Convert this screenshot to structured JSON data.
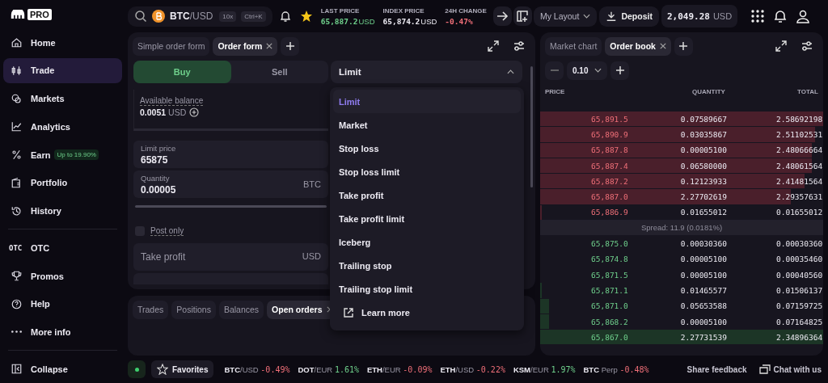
{
  "logo": {
    "badge": "PRO"
  },
  "sidebar": {
    "main": [
      {
        "label": "Home",
        "selected": false
      },
      {
        "label": "Trade",
        "selected": true
      },
      {
        "label": "Markets",
        "selected": false
      },
      {
        "label": "Analytics",
        "selected": false
      },
      {
        "label": "Earn",
        "selected": false,
        "badge": "Up to 19.90%"
      },
      {
        "label": "Portfolio",
        "selected": false
      },
      {
        "label": "History",
        "selected": false
      }
    ],
    "more": [
      {
        "label": "OTC",
        "icon_text": "OTC"
      },
      {
        "label": "Promos"
      },
      {
        "label": "Help"
      },
      {
        "label": "More info"
      }
    ],
    "collapse": "Collapse"
  },
  "topbar": {
    "pair": {
      "base": "BTC",
      "quote": "/USD",
      "leverage": "10x",
      "shortcut": "Ctrl+K"
    },
    "stats": [
      {
        "label": "LAST PRICE",
        "value": "65,887.2",
        "unit": "USD",
        "color": "#6fd08c"
      },
      {
        "label": "INDEX PRICE",
        "value": "65,874.2",
        "unit": "USD",
        "color": "#eceaf2"
      },
      {
        "label": "24H CHANGE",
        "value": "-0.47%",
        "color": "#ef6f78"
      }
    ],
    "layout": "My Layout",
    "deposit": "Deposit",
    "balance": {
      "amount": "2,049.28",
      "unit": "USD"
    }
  },
  "order_form": {
    "tabs": [
      {
        "label": "Simple order form",
        "selected": false,
        "closable": false
      },
      {
        "label": "Order form",
        "selected": true,
        "closable": true
      }
    ],
    "sides": [
      {
        "label": "Buy",
        "selected": true
      },
      {
        "label": "Sell",
        "selected": false
      }
    ],
    "order_type": {
      "value": "Limit",
      "expanded": true,
      "options": [
        {
          "label": "Limit",
          "selected": true
        },
        {
          "label": "Market",
          "selected": false
        },
        {
          "label": "Stop loss",
          "selected": false
        },
        {
          "label": "Stop loss limit",
          "selected": false
        },
        {
          "label": "Take profit",
          "selected": false
        },
        {
          "label": "Take profit limit",
          "selected": false
        },
        {
          "label": "Iceberg",
          "selected": false
        },
        {
          "label": "Trailing stop",
          "selected": false
        },
        {
          "label": "Trailing stop limit",
          "selected": false
        }
      ],
      "learn_more": "Learn more"
    },
    "available_balance": {
      "label": "Available balance",
      "amount": "0.0051",
      "unit": "USD"
    },
    "limit_price": {
      "label": "Limit price",
      "value": "65875"
    },
    "quantity": {
      "label": "Quantity",
      "value": "0.00005",
      "unit": "BTC"
    },
    "post_only": {
      "label": "Post only",
      "checked": false
    },
    "take_profit": {
      "placeholder": "Take profit",
      "unit": "USD"
    }
  },
  "orders_panel": {
    "tabs": [
      {
        "label": "Trades",
        "selected": false,
        "closable": false
      },
      {
        "label": "Positions",
        "selected": false,
        "closable": false
      },
      {
        "label": "Balances",
        "selected": false,
        "closable": false
      },
      {
        "label": "Open orders",
        "selected": true,
        "closable": true
      }
    ]
  },
  "order_book": {
    "tabs": [
      {
        "label": "Market chart",
        "selected": false,
        "closable": false
      },
      {
        "label": "Order book",
        "selected": true,
        "closable": true
      }
    ],
    "tick_size": "0.10",
    "columns": [
      "PRICE",
      "QUANTITY",
      "TOTAL"
    ],
    "asks": [
      {
        "price": "65,891.5",
        "quantity": "0.07589667",
        "total": "2.58692198"
      },
      {
        "price": "65,890.9",
        "quantity": "0.03035867",
        "total": "2.51102531"
      },
      {
        "price": "65,887.8",
        "quantity": "0.00005100",
        "total": "2.48066664"
      },
      {
        "price": "65,887.4",
        "quantity": "0.06580000",
        "total": "2.48061564"
      },
      {
        "price": "65,887.2",
        "quantity": "0.12123933",
        "total": "2.41481564"
      },
      {
        "price": "65,887.0",
        "quantity": "2.27702619",
        "total": "2.29357631"
      },
      {
        "price": "65,886.9",
        "quantity": "0.01655012",
        "total": "0.01655012"
      }
    ],
    "spread": "Spread: 11.9 (0.0181%)",
    "bids": [
      {
        "price": "65,875.0",
        "quantity": "0.00030360",
        "total": "0.00030360"
      },
      {
        "price": "65,874.8",
        "quantity": "0.00005100",
        "total": "0.00035460"
      },
      {
        "price": "65,871.5",
        "quantity": "0.00005100",
        "total": "0.00040560"
      },
      {
        "price": "65,871.1",
        "quantity": "0.01465577",
        "total": "0.01506137"
      },
      {
        "price": "65,871.0",
        "quantity": "0.05653588",
        "total": "0.07159725"
      },
      {
        "price": "65,868.2",
        "quantity": "0.00005100",
        "total": "0.07164825"
      },
      {
        "price": "65,867.0",
        "quantity": "2.27731539",
        "total": "2.34896364"
      }
    ]
  },
  "footer": {
    "connected": true,
    "favorites": "Favorites",
    "tickers": [
      {
        "base": "BTC",
        "quote": "/USD",
        "change": "-0.49%",
        "color": "#ef6f78"
      },
      {
        "base": "DOT",
        "quote": "/EUR",
        "change": "1.61%",
        "color": "#6fd08c"
      },
      {
        "base": "ETH",
        "quote": "/EUR",
        "change": "-0.09%",
        "color": "#ef6f78"
      },
      {
        "base": "ETH",
        "quote": "/USD",
        "change": "-0.22%",
        "color": "#ef6f78"
      },
      {
        "base": "KSM",
        "quote": "/EUR",
        "change": "1.97%",
        "color": "#6fd08c"
      },
      {
        "base": "BTC",
        "quote": " Perp",
        "change": "-0.48%",
        "color": "#ef6f78"
      }
    ],
    "share_feedback": "Share feedback",
    "chat": "Chat with us"
  }
}
